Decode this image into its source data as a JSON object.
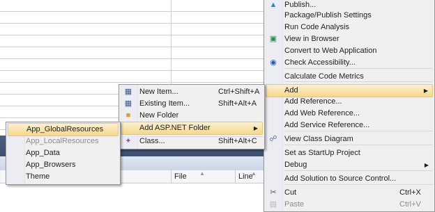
{
  "designer": {
    "columns": {
      "file": "File",
      "line": "Line"
    }
  },
  "main_menu": {
    "items": [
      {
        "label": "Publish...",
        "icon": "publish-icon",
        "shortcut": "",
        "disabled": false
      },
      {
        "label": "Package/Publish Settings",
        "icon": "",
        "shortcut": "",
        "disabled": false
      },
      {
        "label": "Run Code Analysis",
        "icon": "",
        "shortcut": "",
        "disabled": false
      },
      {
        "label": "View in Browser",
        "icon": "browser-icon",
        "shortcut": "",
        "disabled": false
      },
      {
        "label": "Convert to Web Application",
        "icon": "",
        "shortcut": "",
        "disabled": false
      },
      {
        "label": "Check Accessibility...",
        "icon": "accessibility-icon",
        "shortcut": "",
        "disabled": false
      },
      {
        "label": "Calculate Code Metrics",
        "icon": "",
        "shortcut": "",
        "disabled": false
      },
      {
        "label": "Add",
        "icon": "",
        "shortcut": "",
        "disabled": false,
        "submenu": true,
        "highlighted": true
      },
      {
        "label": "Add Reference...",
        "icon": "",
        "shortcut": "",
        "disabled": false
      },
      {
        "label": "Add Web Reference...",
        "icon": "",
        "shortcut": "",
        "disabled": false
      },
      {
        "label": "Add Service Reference...",
        "icon": "",
        "shortcut": "",
        "disabled": false
      },
      {
        "label": "View Class Diagram",
        "icon": "class-diagram-icon",
        "shortcut": "",
        "disabled": false
      },
      {
        "label": "Set as StartUp Project",
        "icon": "",
        "shortcut": "",
        "disabled": false
      },
      {
        "label": "Debug",
        "icon": "",
        "shortcut": "",
        "disabled": false,
        "submenu": true
      },
      {
        "label": "Add Solution to Source Control...",
        "icon": "",
        "shortcut": "",
        "disabled": false
      },
      {
        "label": "Cut",
        "icon": "scissors-icon",
        "shortcut": "Ctrl+X",
        "disabled": false
      },
      {
        "label": "Paste",
        "icon": "paste-icon",
        "shortcut": "Ctrl+V",
        "disabled": true
      }
    ]
  },
  "add_menu": {
    "items": [
      {
        "label": "New Item...",
        "icon": "new-item-icon",
        "shortcut": "Ctrl+Shift+A"
      },
      {
        "label": "Existing Item...",
        "icon": "",
        "shortcut": "Shift+Alt+A"
      },
      {
        "label": "New Folder",
        "icon": "folder-icon",
        "shortcut": ""
      },
      {
        "label": "Add ASP.NET Folder",
        "icon": "",
        "shortcut": "",
        "submenu": true,
        "highlighted": true
      },
      {
        "label": "Class...",
        "icon": "class-icon",
        "shortcut": "Shift+Alt+C"
      }
    ]
  },
  "asp_menu": {
    "items": [
      {
        "label": "App_GlobalResources",
        "highlighted": true,
        "disabled": false
      },
      {
        "label": "App_LocalResources",
        "disabled": true
      },
      {
        "label": "App_Data",
        "disabled": false
      },
      {
        "label": "App_Browsers",
        "disabled": false
      },
      {
        "label": "Theme",
        "disabled": false
      }
    ]
  },
  "colors": {
    "highlight_top": "#fcf0d2",
    "highlight_bottom": "#f6d889",
    "menu_bg": "#f0f0f0",
    "panel_bar": "#4d6082"
  }
}
